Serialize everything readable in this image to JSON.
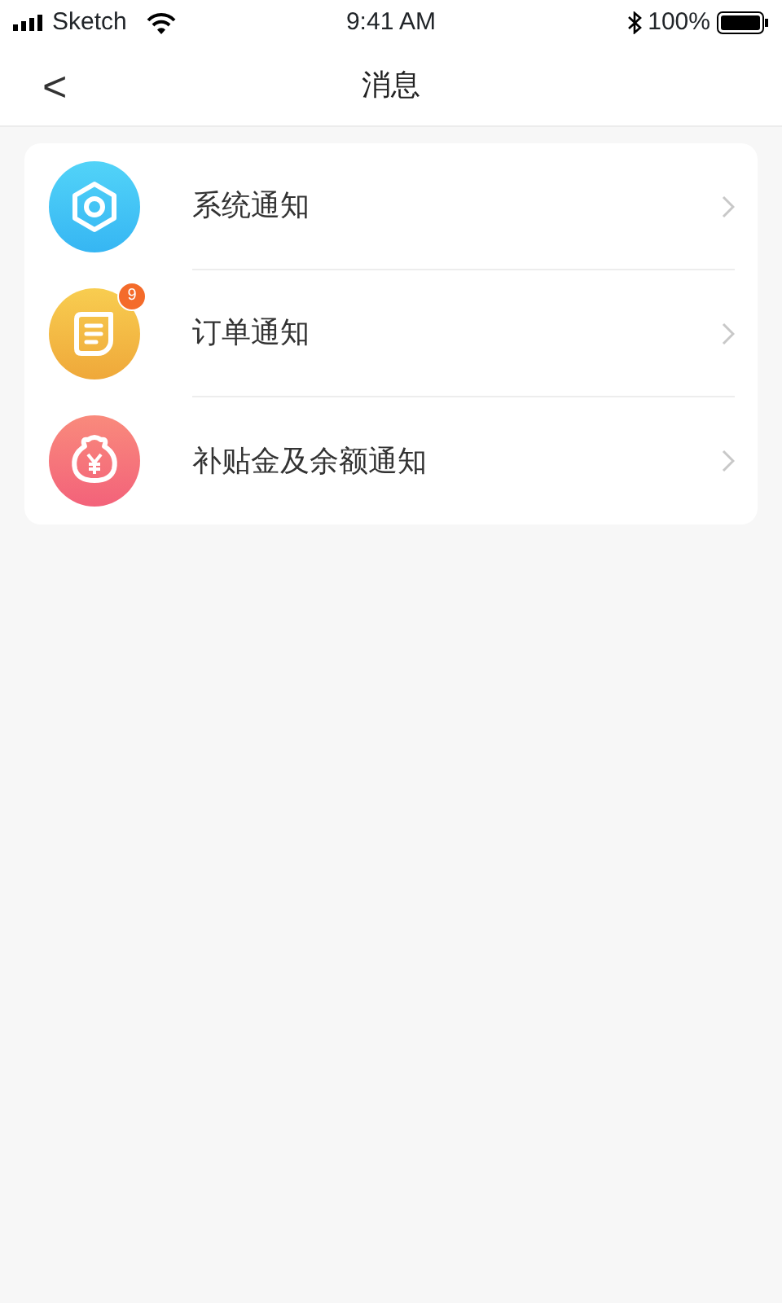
{
  "status_bar": {
    "carrier": "Sketch",
    "time": "9:41 AM",
    "battery": "100%"
  },
  "header": {
    "back": "<",
    "title": "消息"
  },
  "items": [
    {
      "kind": "system",
      "label": "系统通知"
    },
    {
      "kind": "order",
      "label": "订单通知",
      "badge": "9"
    },
    {
      "kind": "money",
      "label": "补贴金及余额通知"
    }
  ]
}
